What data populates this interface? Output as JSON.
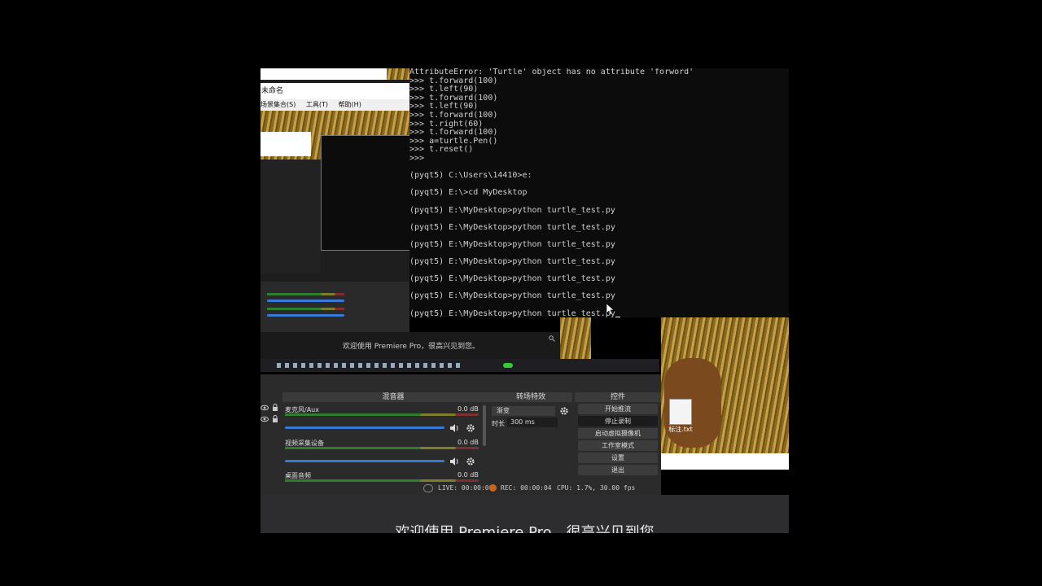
{
  "terminal": {
    "lines": [
      "AttributeError: 'Turtle' object has no attribute 'forword'",
      ">>> t.forward(100)",
      ">>> t.left(90)",
      ">>> t.forward(100)",
      ">>> t.left(90)",
      ">>> t.forward(100)",
      ">>> t.right(60)",
      ">>> t.forward(100)",
      ">>> a=turtle.Pen()",
      ">>> t.reset()",
      ">>>",
      "",
      "(pyqt5) C:\\Users\\14410>e:",
      "",
      "(pyqt5) E:\\>cd MyDesktop",
      "",
      "(pyqt5) E:\\MyDesktop>python turtle_test.py",
      "",
      "(pyqt5) E:\\MyDesktop>python turtle_test.py",
      "",
      "(pyqt5) E:\\MyDesktop>python turtle_test.py",
      "",
      "(pyqt5) E:\\MyDesktop>python turtle_test.py",
      "",
      "(pyqt5) E:\\MyDesktop>python turtle_test.py",
      "",
      "(pyqt5) E:\\MyDesktop>python turtle_test.py",
      "",
      "(pyqt5) E:\\MyDesktop>python turtle_test.py"
    ]
  },
  "nested": {
    "title": "未命名",
    "menu": [
      "场景集合(S)",
      "工具(T)",
      "帮助(H)"
    ]
  },
  "premiere": {
    "welcome": "欢迎使用 Premiere Pro，很高兴见到您。"
  },
  "obs": {
    "mixer": {
      "title": "混音器",
      "channels": [
        {
          "name": "麦克风/Aux",
          "db": "0.0 dB"
        },
        {
          "name": "视频采集设备",
          "db": "0.0 dB"
        },
        {
          "name": "桌面音频",
          "db": "0.0 dB"
        }
      ]
    },
    "transitions": {
      "title": "转场特效",
      "selected": "渐变",
      "duration_label": "时长",
      "duration_value": "300 ms"
    },
    "controls": {
      "title": "控件",
      "buttons": [
        "开始推流",
        "停止录制",
        "启动虚拟摄像机",
        "工作室模式",
        "设置",
        "退出"
      ]
    },
    "status": {
      "live": "LIVE: 00:00:00",
      "rec": "REC: 00:00:04",
      "cpu": "CPU: 1.7%, 30.00 fps"
    }
  },
  "desktop": {
    "file_label": "标注.txt"
  },
  "bottom": {
    "text": "欢迎使用 Premiere Pro，很高兴见到您"
  }
}
